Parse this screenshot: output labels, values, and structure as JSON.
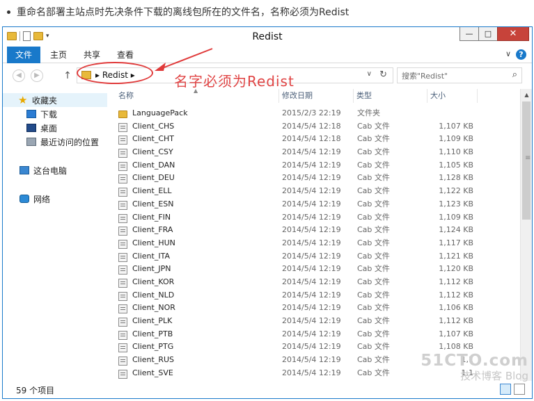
{
  "caption": "重命名部署主站点时先决条件下载的离线包所在的文件名，名称必须为Redist",
  "window": {
    "title": "Redist",
    "minimize": "—",
    "maximize": "□",
    "close": "✕"
  },
  "ribbon": {
    "tabs": [
      "文件",
      "主页",
      "共享",
      "查看"
    ],
    "chevron": "∨",
    "help": "?"
  },
  "address": {
    "crumb": "▸ Redist ▸",
    "dropdown": "∨",
    "refresh": "↻",
    "back": "◀",
    "forward": "▶",
    "up": "↑"
  },
  "search": {
    "placeholder": "搜索\"Redist\"",
    "icon": "⌕"
  },
  "annotation": {
    "text": "名字必须为Redist",
    "color": "#e04444"
  },
  "navpane": {
    "favorites": "收藏夹",
    "items": [
      "下载",
      "桌面",
      "最近访问的位置"
    ],
    "computer": "这台电脑",
    "network": "网络"
  },
  "columns": {
    "name": "名称",
    "date": "修改日期",
    "type": "类型",
    "size": "大小"
  },
  "files": [
    {
      "name": "LanguagePack",
      "date": "2015/2/3 22:19",
      "type": "文件夹",
      "size": "",
      "kind": "folder"
    },
    {
      "name": "Client_CHS",
      "date": "2014/5/4 12:18",
      "type": "Cab 文件",
      "size": "1,107 KB",
      "kind": "cab"
    },
    {
      "name": "Client_CHT",
      "date": "2014/5/4 12:18",
      "type": "Cab 文件",
      "size": "1,109 KB",
      "kind": "cab"
    },
    {
      "name": "Client_CSY",
      "date": "2014/5/4 12:19",
      "type": "Cab 文件",
      "size": "1,110 KB",
      "kind": "cab"
    },
    {
      "name": "Client_DAN",
      "date": "2014/5/4 12:19",
      "type": "Cab 文件",
      "size": "1,105 KB",
      "kind": "cab"
    },
    {
      "name": "Client_DEU",
      "date": "2014/5/4 12:19",
      "type": "Cab 文件",
      "size": "1,128 KB",
      "kind": "cab"
    },
    {
      "name": "Client_ELL",
      "date": "2014/5/4 12:19",
      "type": "Cab 文件",
      "size": "1,122 KB",
      "kind": "cab"
    },
    {
      "name": "Client_ESN",
      "date": "2014/5/4 12:19",
      "type": "Cab 文件",
      "size": "1,123 KB",
      "kind": "cab"
    },
    {
      "name": "Client_FIN",
      "date": "2014/5/4 12:19",
      "type": "Cab 文件",
      "size": "1,109 KB",
      "kind": "cab"
    },
    {
      "name": "Client_FRA",
      "date": "2014/5/4 12:19",
      "type": "Cab 文件",
      "size": "1,124 KB",
      "kind": "cab"
    },
    {
      "name": "Client_HUN",
      "date": "2014/5/4 12:19",
      "type": "Cab 文件",
      "size": "1,117 KB",
      "kind": "cab"
    },
    {
      "name": "Client_ITA",
      "date": "2014/5/4 12:19",
      "type": "Cab 文件",
      "size": "1,121 KB",
      "kind": "cab"
    },
    {
      "name": "Client_JPN",
      "date": "2014/5/4 12:19",
      "type": "Cab 文件",
      "size": "1,120 KB",
      "kind": "cab"
    },
    {
      "name": "Client_KOR",
      "date": "2014/5/4 12:19",
      "type": "Cab 文件",
      "size": "1,112 KB",
      "kind": "cab"
    },
    {
      "name": "Client_NLD",
      "date": "2014/5/4 12:19",
      "type": "Cab 文件",
      "size": "1,112 KB",
      "kind": "cab"
    },
    {
      "name": "Client_NOR",
      "date": "2014/5/4 12:19",
      "type": "Cab 文件",
      "size": "1,106 KB",
      "kind": "cab"
    },
    {
      "name": "Client_PLK",
      "date": "2014/5/4 12:19",
      "type": "Cab 文件",
      "size": "1,112 KB",
      "kind": "cab"
    },
    {
      "name": "Client_PTB",
      "date": "2014/5/4 12:19",
      "type": "Cab 文件",
      "size": "1,107 KB",
      "kind": "cab"
    },
    {
      "name": "Client_PTG",
      "date": "2014/5/4 12:19",
      "type": "Cab 文件",
      "size": "1,108 KB",
      "kind": "cab"
    },
    {
      "name": "Client_RUS",
      "date": "2014/5/4 12:19",
      "type": "Cab 文件",
      "size": "1,1",
      "kind": "cab"
    },
    {
      "name": "Client_SVE",
      "date": "2014/5/4 12:19",
      "type": "Cab 文件",
      "size": "1,1",
      "kind": "cab"
    }
  ],
  "status": {
    "count": "59 个项目"
  },
  "watermark": {
    "line1": "51CTO.com",
    "line2": "技术博客 Blog"
  }
}
